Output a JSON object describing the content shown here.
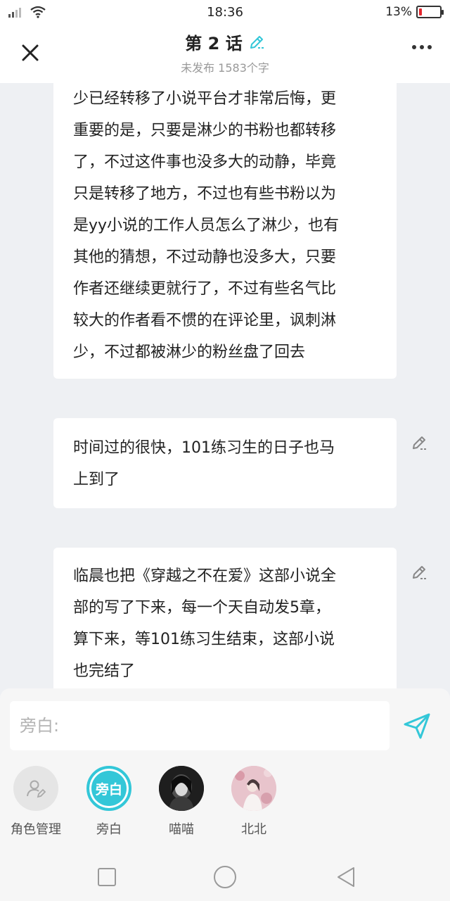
{
  "status": {
    "time": "18:36",
    "battery_percent": "13%",
    "battery_level": 0.13,
    "battery_color": "#e3262d"
  },
  "header": {
    "title": "第 2 话",
    "subtitle": "未发布 1583个字",
    "accent_color": "#33c7d8"
  },
  "cards": [
    {
      "lines": [
        "少已经转移了小说平台才非常后悔，更",
        "重要的是，只要是淋少的书粉也都转移",
        "了，不过这件事也没多大的动静，毕竟",
        "只是转移了地方，不过也有些书粉以为",
        "是yy小说的工作人员怎么了淋少，也有",
        "其他的猜想，不过动静也没多大，只要",
        "作者还继续更就行了，不过有些名气比",
        "较大的作者看不惯的在评论里，讽刺淋",
        "少，不过都被淋少的粉丝盘了回去"
      ]
    },
    {
      "lines": [
        "时间过的很快，101练习生的日子也马",
        "上到了"
      ]
    },
    {
      "lines": [
        "临晨也把《穿越之不在爱》这部小说全",
        "部的写了下来，每一个天自动发5章，",
        "算下来，等101练习生结束，这部小说",
        "也完结了"
      ]
    }
  ],
  "input": {
    "placeholder": "旁白:"
  },
  "roles": [
    {
      "label": "角色管理",
      "icon": "role-manage-icon"
    },
    {
      "label": "旁白",
      "avatar_text": "旁白",
      "selected": true
    },
    {
      "label": "喵喵",
      "icon": "avatar-photo"
    },
    {
      "label": "北北",
      "icon": "avatar-photo"
    }
  ]
}
